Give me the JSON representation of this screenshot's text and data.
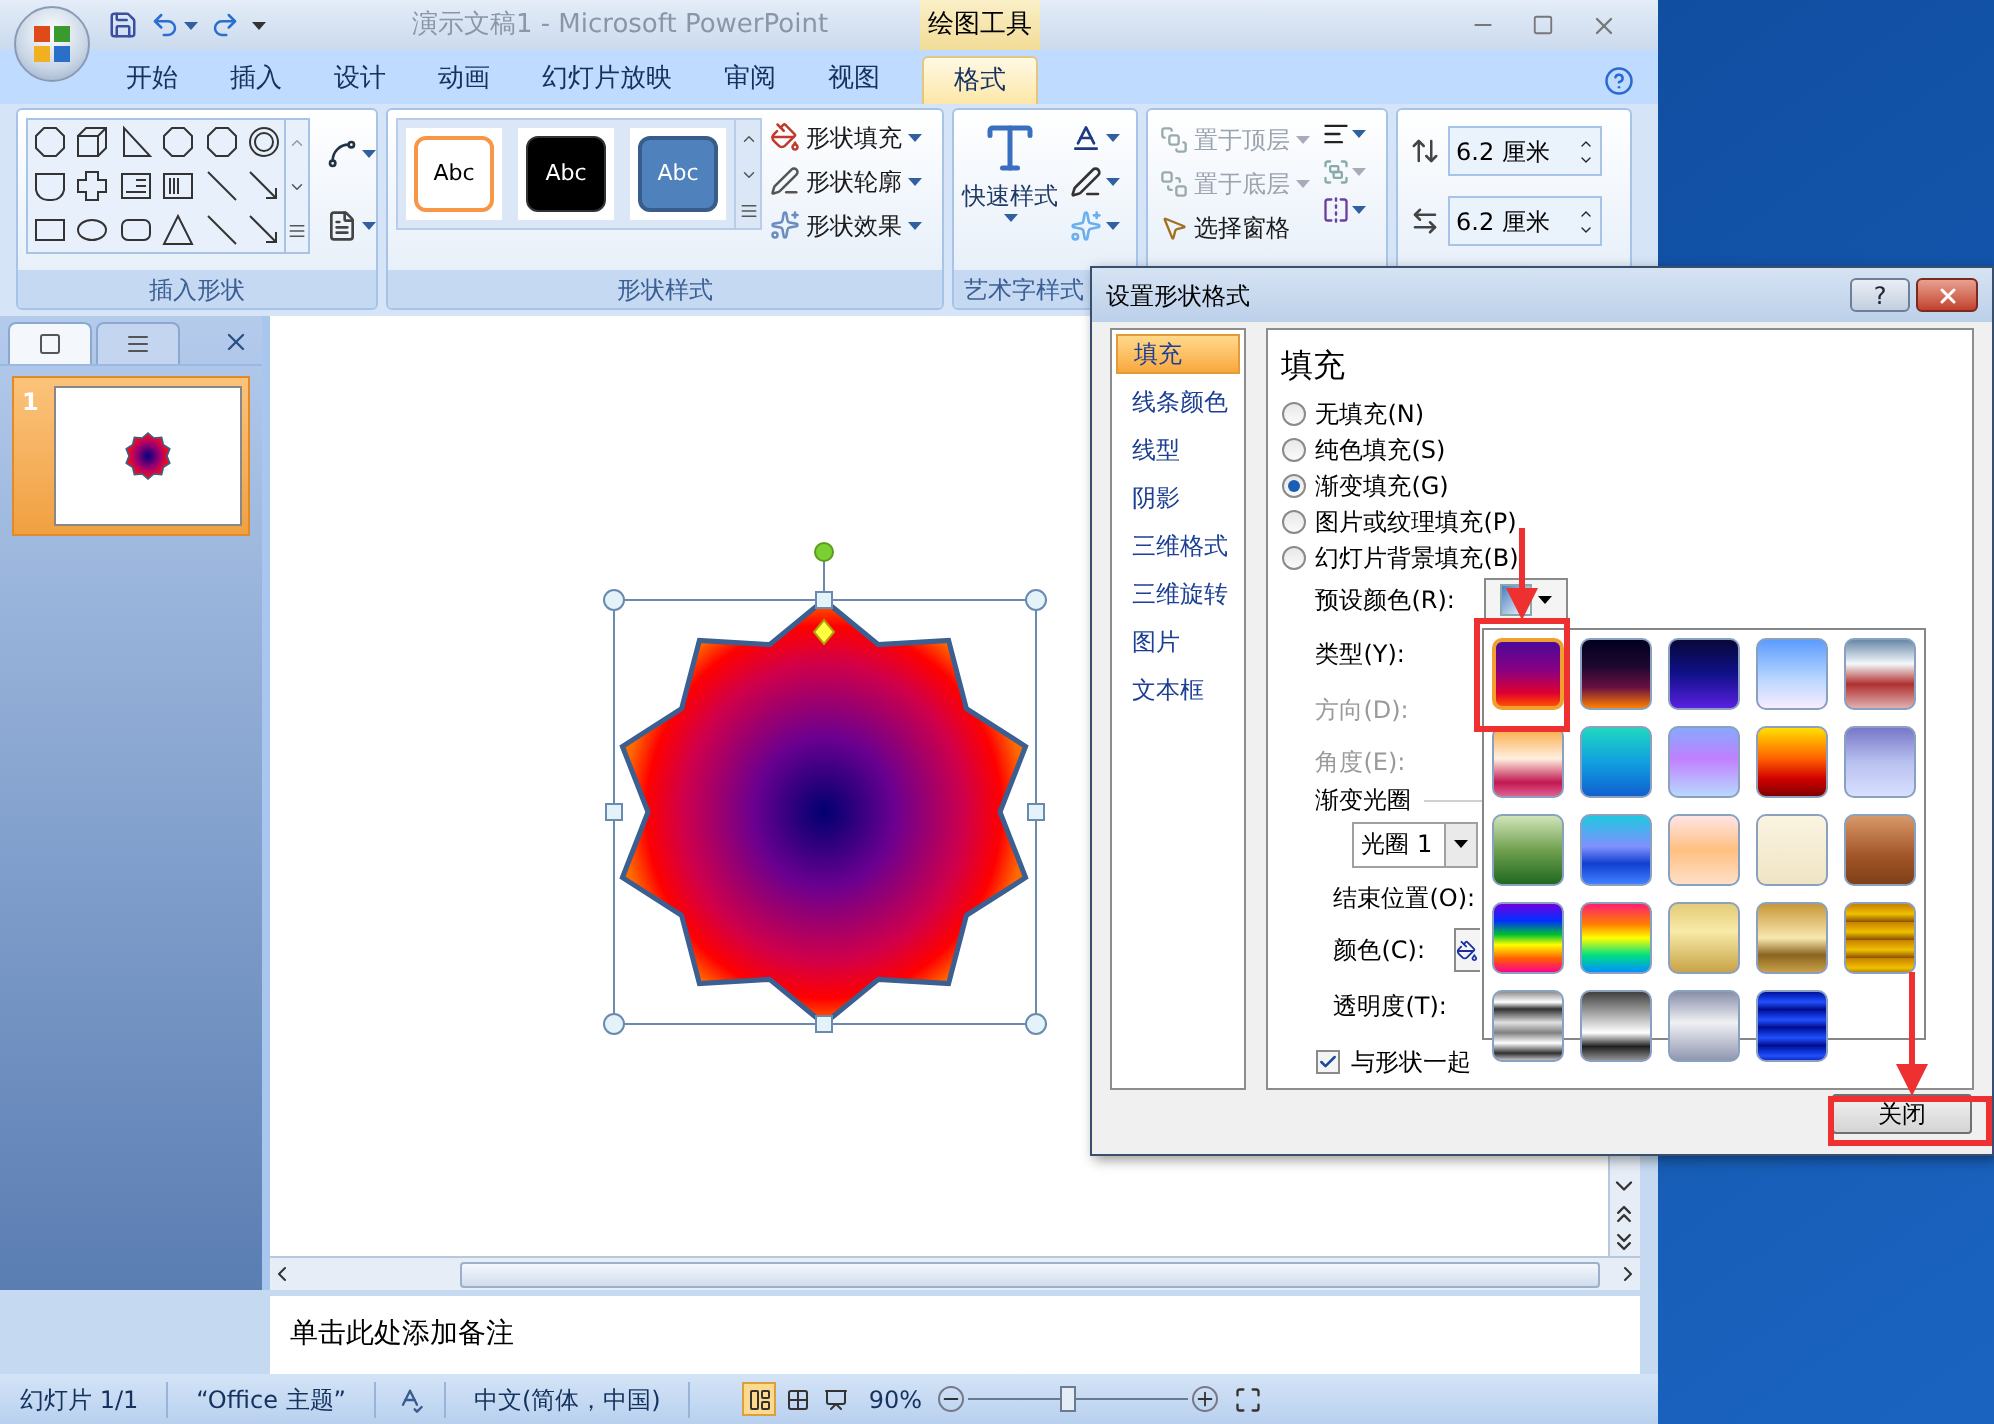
{
  "window": {
    "title": "演示文稿1 - Microsoft PowerPoint",
    "contextual_tab": "绘图工具"
  },
  "ribbon_tabs": [
    {
      "label": "开始",
      "selected": false
    },
    {
      "label": "插入",
      "selected": false
    },
    {
      "label": "设计",
      "selected": false
    },
    {
      "label": "动画",
      "selected": false
    },
    {
      "label": "幻灯片放映",
      "selected": false
    },
    {
      "label": "审阅",
      "selected": false
    },
    {
      "label": "视图",
      "selected": false
    },
    {
      "label": "格式",
      "selected": true
    }
  ],
  "ribbon": {
    "insert_shapes": {
      "label": "插入形状"
    },
    "shape_styles": {
      "label": "形状样式",
      "samples": [
        {
          "label": "Abc",
          "kind": "outline"
        },
        {
          "label": "Abc",
          "kind": "dark"
        },
        {
          "label": "Abc",
          "kind": "blue"
        }
      ],
      "commands": [
        {
          "label": "形状填充",
          "kind": "fill"
        },
        {
          "label": "形状轮廓",
          "kind": "outline"
        },
        {
          "label": "形状效果",
          "kind": "effect"
        }
      ]
    },
    "wordart_styles": {
      "label": "艺术字样式",
      "quick_styles": "快速样式"
    },
    "arrange": {
      "commands": [
        {
          "label": "置于顶层",
          "kind": "front",
          "disabled": true
        },
        {
          "label": "置于底层",
          "kind": "back",
          "disabled": true
        },
        {
          "label": "选择窗格",
          "kind": "pane",
          "disabled": false
        }
      ]
    },
    "size": {
      "fields": [
        {
          "kind": "height",
          "value": "6.2 厘米"
        },
        {
          "kind": "width",
          "value": "6.2 厘米"
        }
      ]
    }
  },
  "slide_panel": {
    "tabs": [
      {
        "kind": "slides",
        "selected": true
      },
      {
        "kind": "outline",
        "selected": false
      }
    ],
    "slides": [
      {
        "number": "1",
        "selected": true
      }
    ]
  },
  "notes": {
    "placeholder": "单击此处添加备注"
  },
  "status_bar": {
    "slide": "幻灯片 1/1",
    "theme": "“Office 主题”",
    "language": "中文(简体，中国)",
    "views": [
      {
        "kind": "normal",
        "selected": true
      },
      {
        "kind": "sorter",
        "selected": false
      },
      {
        "kind": "show",
        "selected": false
      }
    ],
    "zoom": "90%",
    "zoom_slider": {
      "level": 0.45
    }
  },
  "dialog": {
    "title": "设置形状格式",
    "help_button": "?",
    "nav": [
      {
        "label": "填充",
        "selected": true
      },
      {
        "label": "线条颜色",
        "selected": false
      },
      {
        "label": "线型",
        "selected": false
      },
      {
        "label": "阴影",
        "selected": false
      },
      {
        "label": "三维格式",
        "selected": false
      },
      {
        "label": "三维旋转",
        "selected": false
      },
      {
        "label": "图片",
        "selected": false
      },
      {
        "label": "文本框",
        "selected": false
      }
    ],
    "heading": "填充",
    "fill_options": [
      {
        "label": "无填充(N)",
        "selected": false
      },
      {
        "label": "纯色填充(S)",
        "selected": false
      },
      {
        "label": "渐变填充(G)",
        "selected": true
      },
      {
        "label": "图片或纹理填充(P)",
        "selected": false
      },
      {
        "label": "幻灯片背景填充(B)",
        "selected": false
      }
    ],
    "preset_colors": {
      "label": "预设颜色(R):"
    },
    "type": {
      "label": "类型(Y):"
    },
    "direction": {
      "label": "方向(D):",
      "disabled": true
    },
    "angle": {
      "label": "角度(E):",
      "disabled": true
    },
    "gradient_stops": {
      "label": "渐变光圈",
      "stop": "光圈 1"
    },
    "end_position": {
      "label": "结束位置(O):"
    },
    "color": {
      "label": "颜色(C):"
    },
    "transparency": {
      "label": "透明度(T):"
    },
    "rotate_with_shape": {
      "label": "与形状一起",
      "checked": true
    },
    "close_button": "关闭",
    "gallery": {
      "swatches": [
        {
          "selected": true
        },
        {
          "selected": false
        },
        {
          "selected": false
        },
        {
          "selected": false
        },
        {
          "selected": false
        },
        {
          "selected": false
        },
        {
          "selected": false
        },
        {
          "selected": false
        },
        {
          "selected": false
        },
        {
          "selected": false
        },
        {
          "selected": false
        },
        {
          "selected": false
        },
        {
          "selected": false
        },
        {
          "selected": false
        },
        {
          "selected": false
        },
        {
          "selected": false
        },
        {
          "selected": false
        },
        {
          "selected": false
        },
        {
          "selected": false
        },
        {
          "selected": false
        },
        {
          "selected": false
        },
        {
          "selected": false
        },
        {
          "selected": false
        },
        {
          "selected": false
        }
      ]
    }
  }
}
